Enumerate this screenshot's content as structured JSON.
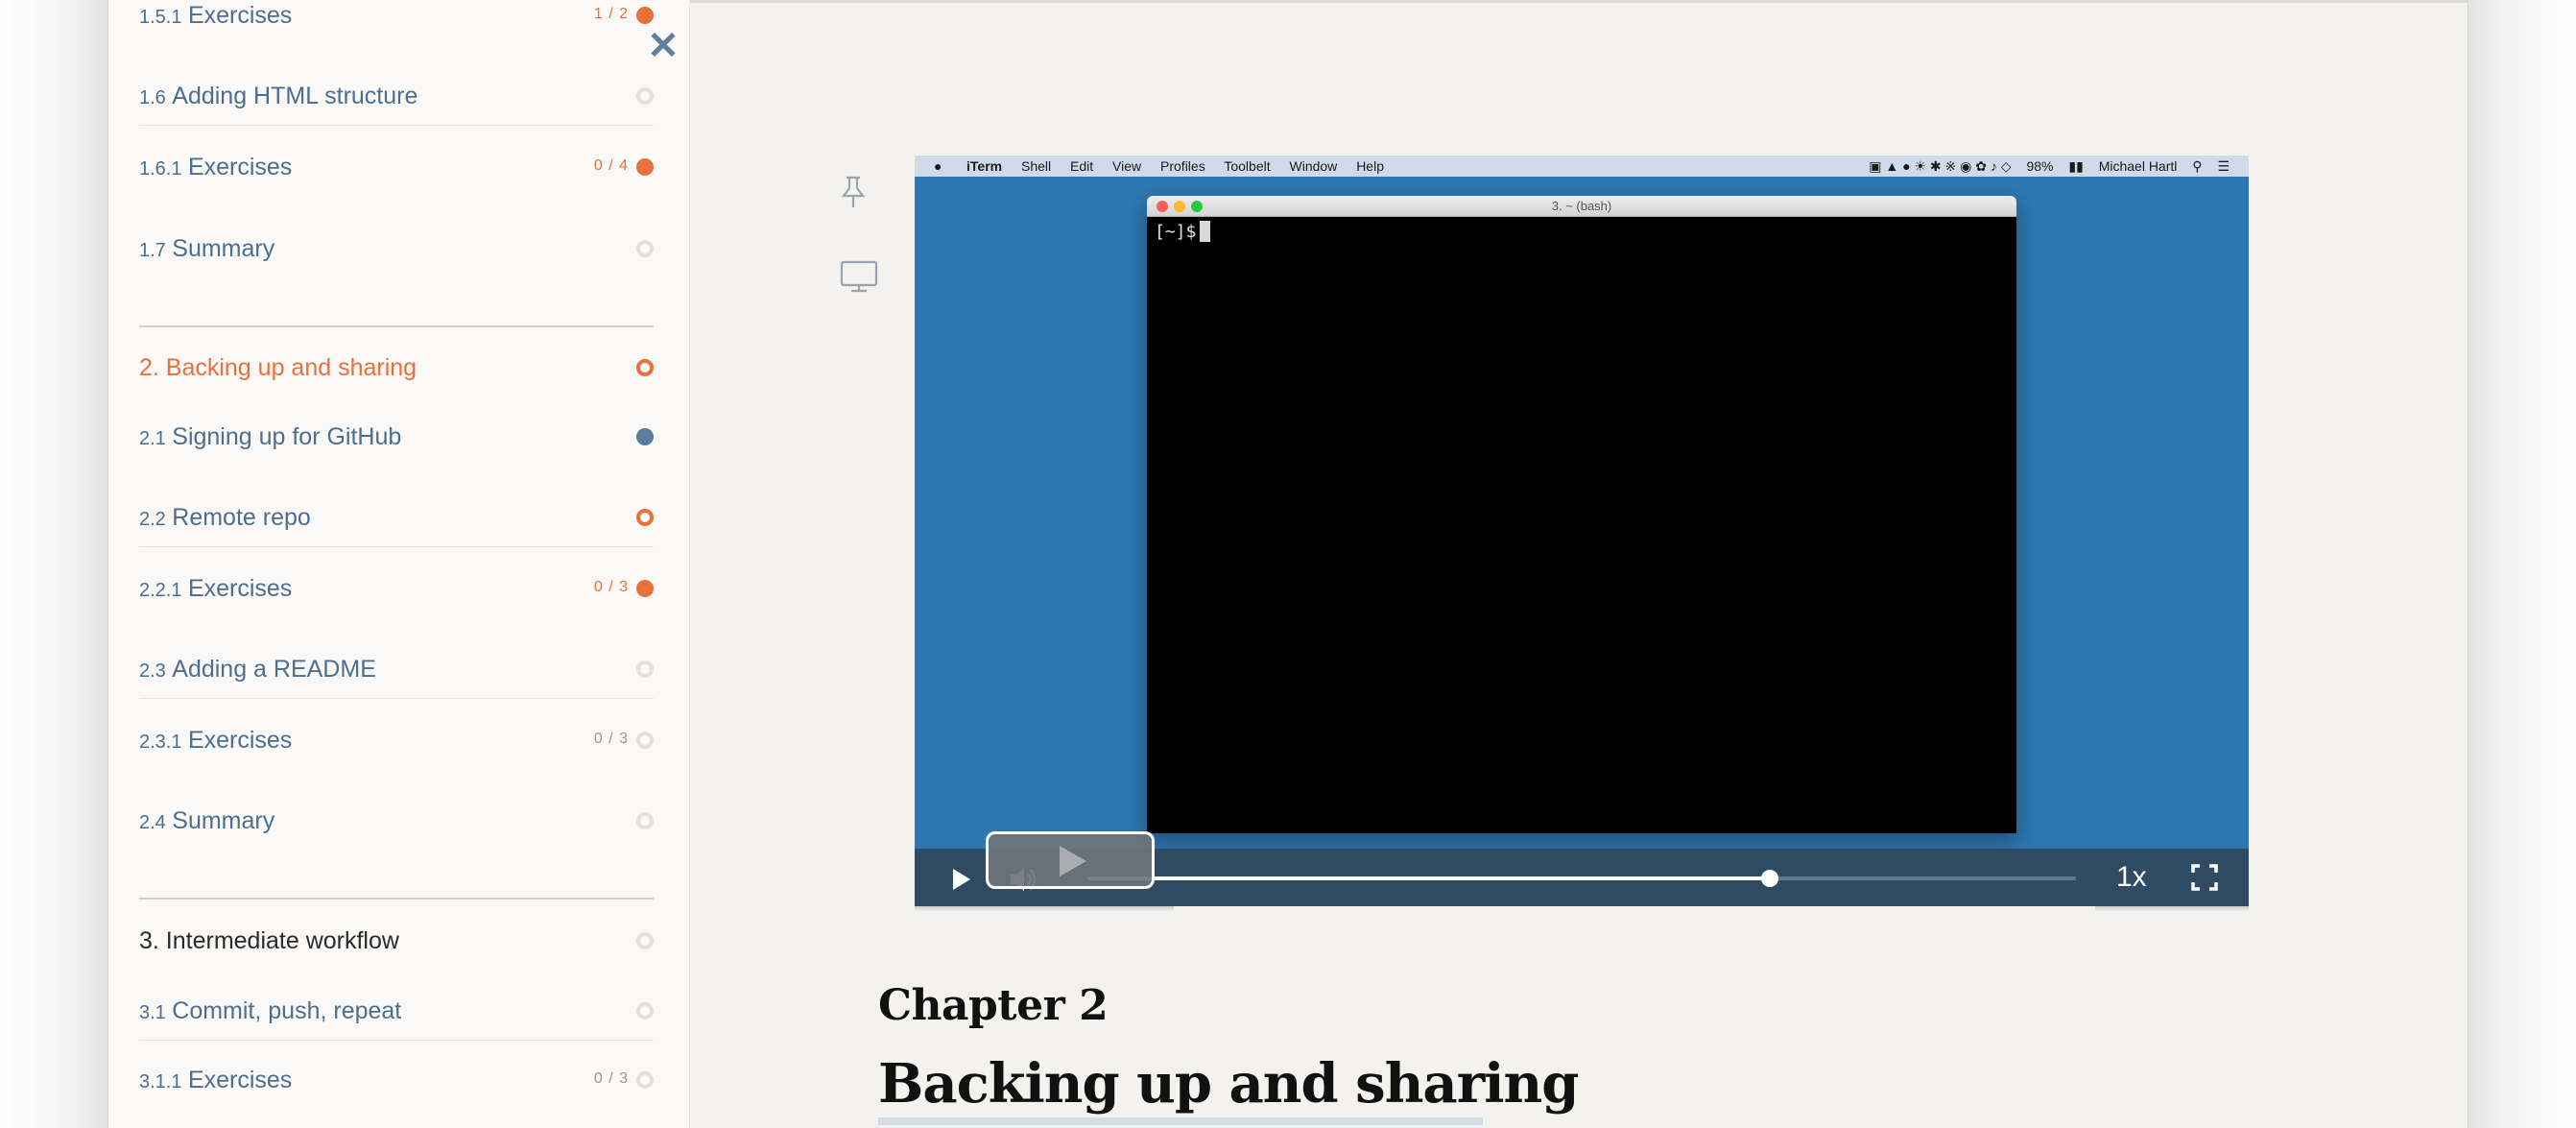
{
  "sidebar": {
    "items": [
      {
        "num": "1.5.1",
        "label": "Exercises",
        "count": "1 / 2",
        "status": "full"
      },
      {
        "num": "1.6",
        "label": "Adding HTML structure",
        "count": "",
        "status": "empty"
      },
      {
        "num": "1.6.1",
        "label": "Exercises",
        "count": "0 / 4",
        "status": "full"
      },
      {
        "num": "1.7",
        "label": "Summary",
        "count": "",
        "status": "empty"
      },
      {
        "num": "",
        "label": "2. Backing up and sharing",
        "count": "",
        "status": "ring"
      },
      {
        "num": "2.1",
        "label": "Signing up for GitHub",
        "count": "",
        "status": "blue"
      },
      {
        "num": "2.2",
        "label": "Remote repo",
        "count": "",
        "status": "ring"
      },
      {
        "num": "2.2.1",
        "label": "Exercises",
        "count": "0 / 3",
        "status": "full"
      },
      {
        "num": "2.3",
        "label": "Adding a README",
        "count": "",
        "status": "empty"
      },
      {
        "num": "2.3.1",
        "label": "Exercises",
        "count": "0 / 3",
        "status": "empty"
      },
      {
        "num": "2.4",
        "label": "Summary",
        "count": "",
        "status": "empty"
      },
      {
        "num": "",
        "label": "3. Intermediate workflow",
        "count": "",
        "status": "empty"
      },
      {
        "num": "3.1",
        "label": "Commit, push, repeat",
        "count": "",
        "status": "empty"
      },
      {
        "num": "3.1.1",
        "label": "Exercises",
        "count": "0 / 3",
        "status": "empty"
      }
    ]
  },
  "video": {
    "menubar": {
      "app": "iTerm",
      "menus": [
        "Shell",
        "Edit",
        "View",
        "Profiles",
        "Toolbelt",
        "Window",
        "Help"
      ],
      "battery": "98%",
      "user": "Michael Hartl"
    },
    "terminal": {
      "title": "3. ~ (bash)",
      "prompt": "[~]$"
    },
    "controls": {
      "speed": "1x",
      "progress": 0.69
    }
  },
  "content": {
    "chapter_label": "Chapter 2",
    "chapter_title": "Backing up and sharing"
  },
  "colors": {
    "accent": "#e8703a",
    "link": "#4b6e91",
    "video_bg": "#2e77b2",
    "controls_bg": "#2f4a63"
  }
}
